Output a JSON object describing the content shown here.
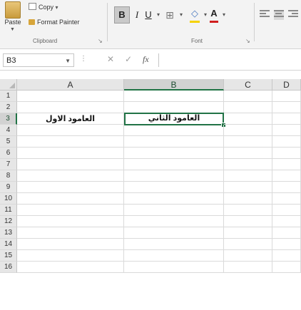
{
  "ribbon": {
    "paste_label": "Paste",
    "copy_label": "Copy",
    "format_painter_label": "Format Painter",
    "clipboard_group": "Clipboard",
    "font_group": "Font",
    "bold": "B",
    "italic": "I",
    "underline": "U",
    "borders_icon": "borders-icon",
    "fill_color_icon": "fill-color-icon",
    "font_color": "A",
    "fill_color": "#f5d200",
    "font_color_value": "#d01f1f"
  },
  "formula_bar": {
    "name_box": "B3",
    "fx": "fx",
    "value": ""
  },
  "grid": {
    "columns": [
      "A",
      "B",
      "C",
      "D"
    ],
    "selected_column": "B",
    "rows": [
      "1",
      "2",
      "3",
      "4",
      "5",
      "6",
      "7",
      "8",
      "9",
      "10",
      "11",
      "12",
      "13",
      "14",
      "15",
      "16"
    ],
    "selected_row": "3",
    "cells": {
      "A3": "العامود الاول",
      "B3": "العامود الثاني"
    },
    "accent_color": "#217346"
  }
}
